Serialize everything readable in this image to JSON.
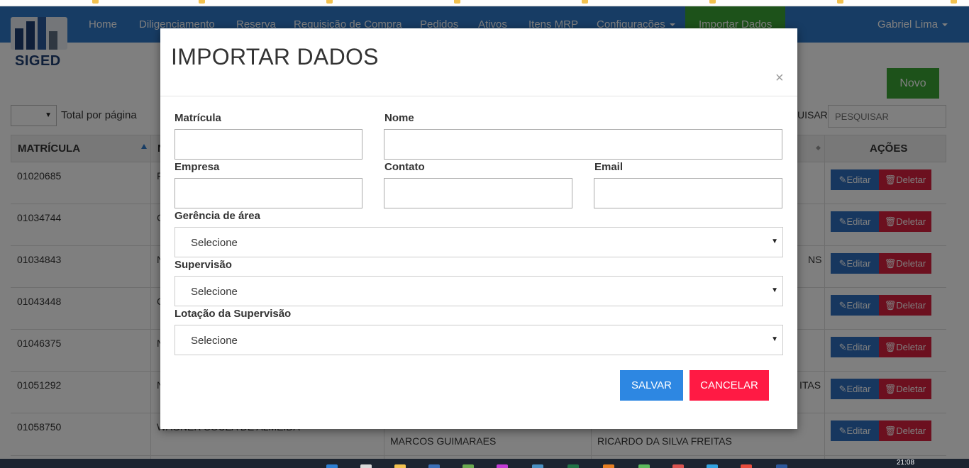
{
  "navbar": {
    "items": [
      "Home",
      "Diligenciamento",
      "Reserva",
      "Requisição de Compra",
      "Pedidos",
      "Ativos",
      "Itens MRP",
      "Configurações",
      "Importar Dados"
    ],
    "user": "Gabriel Lima",
    "colors": {
      "nav": "#2f78c8",
      "active": "#3aa535"
    }
  },
  "logo": {
    "label": "SIGED"
  },
  "page": {
    "new_button": "Novo",
    "per_page_label": "Total por página",
    "search_label": "UISAR:",
    "search_placeholder": "PESQUISAR"
  },
  "table": {
    "headers": [
      "MATRÍCULA",
      "N",
      "AÇÕES"
    ],
    "edit_label": "Editar",
    "delete_label": "Deletar",
    "rows": [
      {
        "matricula": "01020685",
        "nome": "F",
        "gerencia": "",
        "supervisao": ""
      },
      {
        "matricula": "01034744",
        "nome": "C",
        "gerencia": "",
        "supervisao": ""
      },
      {
        "matricula": "01034843",
        "nome": "N",
        "gerencia": "",
        "supervisao": "NS"
      },
      {
        "matricula": "01043448",
        "nome": "C",
        "gerencia": "",
        "supervisao": ""
      },
      {
        "matricula": "01046375",
        "nome": "N",
        "gerencia": "",
        "supervisao": ""
      },
      {
        "matricula": "01051292",
        "nome": "N",
        "gerencia": "",
        "supervisao": "ITAS"
      },
      {
        "matricula": "01058750",
        "nome": "WAGNER SOUZA DE ALMEIDA",
        "gerencia": "MARCOS GUIMARAES",
        "supervisao": "RICARDO DA SILVA FREITAS"
      }
    ]
  },
  "modal": {
    "title": "IMPORTAR DADOS",
    "close": "×",
    "fields": {
      "matricula": "Matrícula",
      "nome": "Nome",
      "empresa": "Empresa",
      "contato": "Contato",
      "email": "Email",
      "gerencia": "Gerência de área",
      "supervisao": "Supervisão",
      "lotacao": "Lotação da Supervisão"
    },
    "select_placeholder": "Selecione",
    "save": "SALVAR",
    "cancel": "CANCELAR",
    "colors": {
      "save": "#2d87e2",
      "cancel": "#ff1a44"
    }
  },
  "taskbar": {
    "clock": "21:08"
  }
}
